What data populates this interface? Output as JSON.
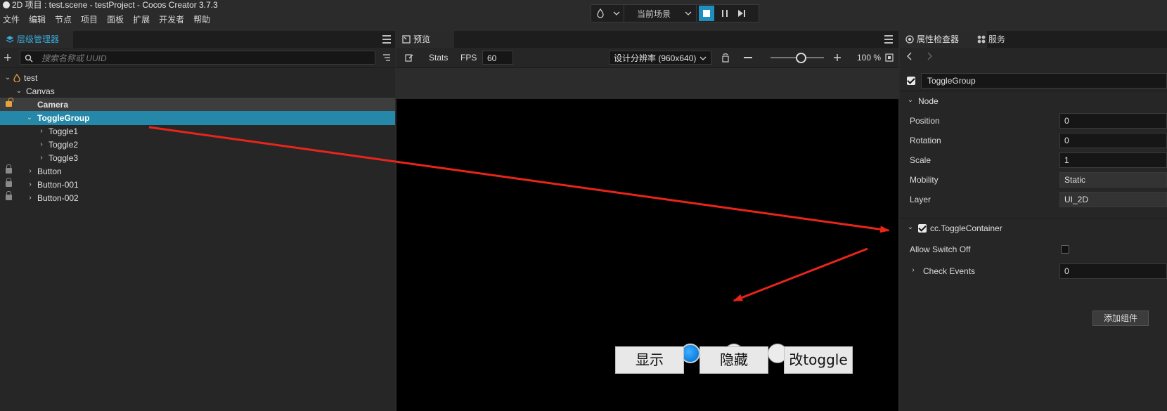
{
  "window": {
    "title": "2D 项目 : test.scene - testProject - Cocos Creator 3.7.3"
  },
  "menu": [
    "文件",
    "编辑",
    "节点",
    "项目",
    "面板",
    "扩展",
    "开发者",
    "帮助"
  ],
  "toolbar": {
    "scene_select": "当前场景"
  },
  "hierarchy": {
    "tab_label": "层级管理器",
    "search_placeholder": "搜索名称或 UUID",
    "nodes": [
      "test",
      "Canvas",
      "Camera",
      "ToggleGroup",
      "Toggle1",
      "Toggle2",
      "Toggle3",
      "Button",
      "Button-001",
      "Button-002"
    ],
    "selected": "ToggleGroup"
  },
  "preview": {
    "tab_label": "预览",
    "stats_label": "Stats",
    "fps_label": "FPS",
    "fps_value": "60",
    "resolution": "设计分辨率 (960x640)",
    "zoom": "100 %",
    "toggles": [
      {
        "checked": true
      },
      {
        "checked": false
      },
      {
        "checked": false
      }
    ],
    "buttons": [
      "显示",
      "隐藏",
      "改toggle"
    ]
  },
  "inspector": {
    "tab_label": "属性检查器",
    "tab2_label": "服务",
    "node_name": "ToggleGroup",
    "node_section": "Node",
    "props": [
      {
        "label": "Position",
        "value": "0"
      },
      {
        "label": "Rotation",
        "value": "0"
      },
      {
        "label": "Scale",
        "value": "1"
      },
      {
        "label": "Mobility",
        "value": "Static"
      },
      {
        "label": "Layer",
        "value": "UI_2D"
      }
    ],
    "component": "cc.ToggleContainer",
    "allow_switch_off_label": "Allow Switch Off",
    "allow_switch_off": false,
    "check_events_label": "Check Events",
    "check_events_value": "0",
    "add_component": "添加组件"
  },
  "colors": {
    "accent": "#2588a8",
    "annotation": "#e8251b"
  }
}
